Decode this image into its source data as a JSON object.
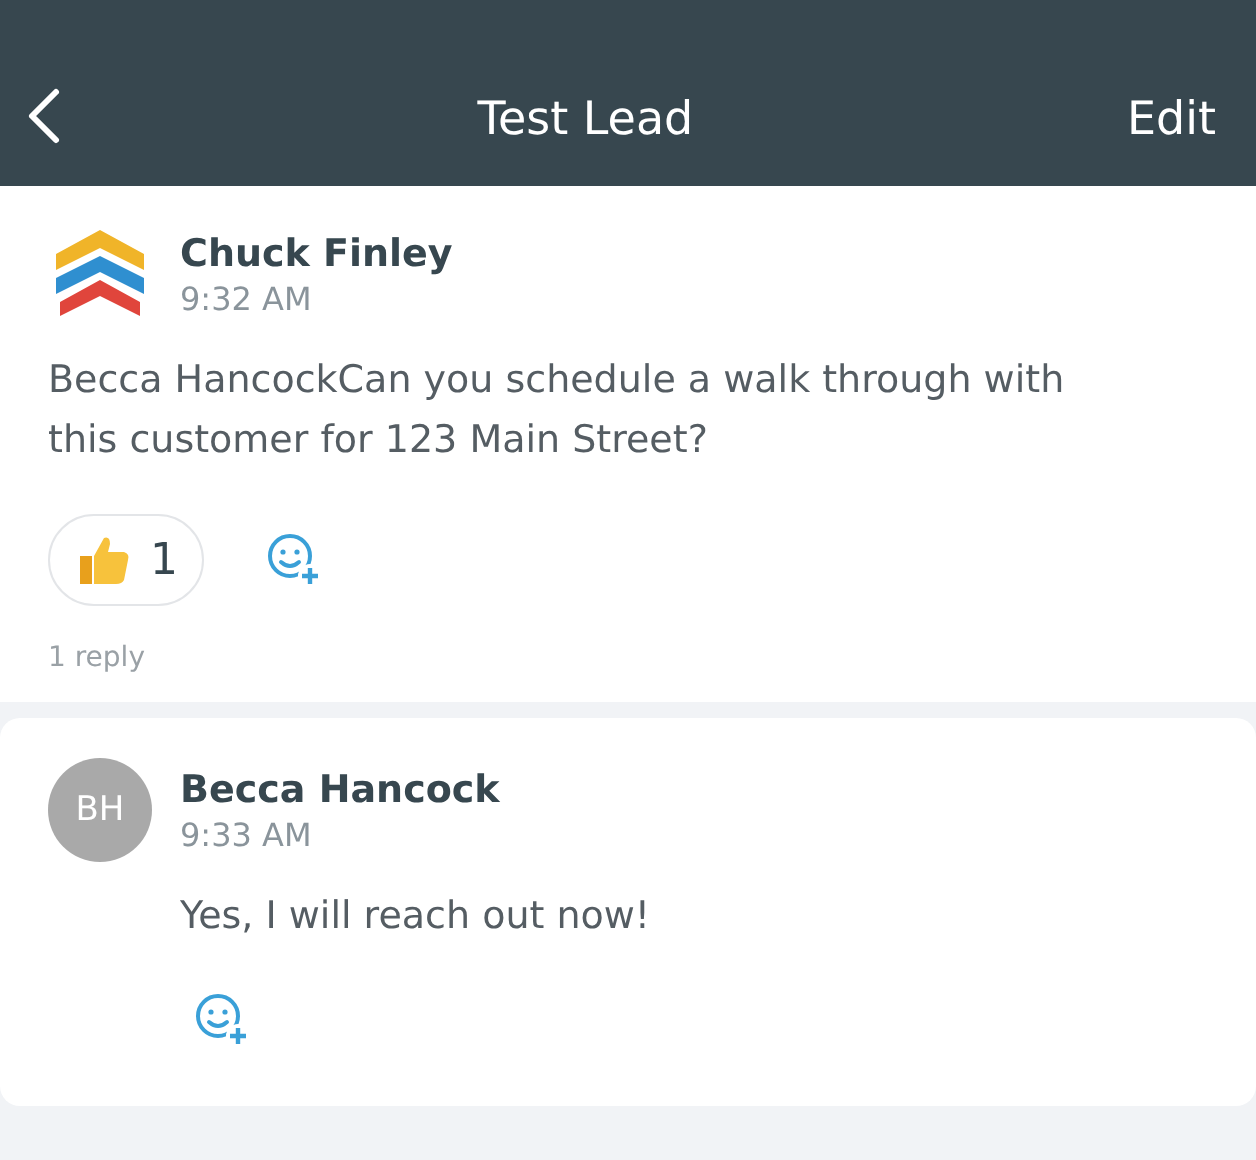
{
  "header": {
    "title": "Test Lead",
    "action": "Edit"
  },
  "posts": [
    {
      "kind": "post",
      "avatar": {
        "kind": "logo"
      },
      "author": "Chuck Finley",
      "time": "9:32 AM",
      "text": "Becca HancockCan you schedule a walk through with this customer for 123 Main Street?",
      "reactions": [
        {
          "kind": "thumbs_up",
          "count": "1"
        }
      ],
      "replies": "1 reply"
    },
    {
      "kind": "reply",
      "avatar": {
        "kind": "initials",
        "initials": "BH"
      },
      "author": "Becca Hancock",
      "time": "9:33 AM",
      "text": "Yes, I will reach out now!"
    }
  ]
}
